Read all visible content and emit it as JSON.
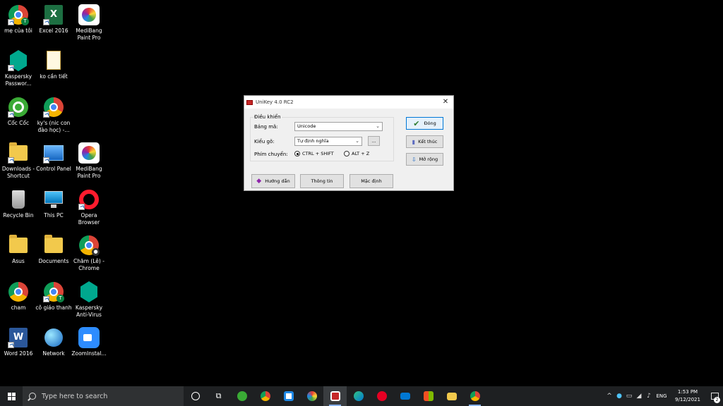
{
  "desktop_icons": [
    {
      "label": "mẹ của tôi",
      "icon": "chrome-profile-icon"
    },
    {
      "label": "Excel 2016",
      "icon": "excel-icon"
    },
    {
      "label": "MediBang Paint Pro",
      "icon": "medibang-icon"
    },
    {
      "label": "Kaspersky Passwor...",
      "icon": "kaspersky-icon"
    },
    {
      "label": "ko cần tiết",
      "icon": "document-icon"
    },
    {
      "label": "Cốc Cốc",
      "icon": "coccoc-icon"
    },
    {
      "label": "ky's (nic con đào học) -...",
      "icon": "chrome-profile-icon"
    },
    {
      "label": "Downloads - Shortcut",
      "icon": "folder-download-icon"
    },
    {
      "label": "Control Panel",
      "icon": "control-panel-icon"
    },
    {
      "label": "MediBang Paint Pro",
      "icon": "medibang-icon"
    },
    {
      "label": "Recycle Bin",
      "icon": "recycle-bin-icon"
    },
    {
      "label": "This PC",
      "icon": "this-pc-icon"
    },
    {
      "label": "Opera Browser",
      "icon": "opera-icon"
    },
    {
      "label": "Asus",
      "icon": "folder-user-icon"
    },
    {
      "label": "Documents",
      "icon": "documents-folder-icon"
    },
    {
      "label": "Chăm (Lê) - Chrome",
      "icon": "chrome-profile-icon"
    },
    {
      "label": "cham",
      "icon": "chrome-icon"
    },
    {
      "label": "cô giáo thanh",
      "icon": "chrome-profile-icon"
    },
    {
      "label": "Kaspersky Anti-Virus",
      "icon": "kaspersky-icon"
    },
    {
      "label": "Word 2016",
      "icon": "word-icon"
    },
    {
      "label": "Network",
      "icon": "network-icon"
    },
    {
      "label": "ZoomInstal...",
      "icon": "zoom-icon"
    }
  ],
  "unikey": {
    "title": "UniKey 4.0 RC2",
    "group_label": "Điều khiển",
    "bang_ma_label": "Bảng mã:",
    "bang_ma_value": "Unicode",
    "kieu_go_label": "Kiểu gõ:",
    "kieu_go_value": "Tự định nghĩa",
    "ellipsis_label": "...",
    "phim_chuyen_label": "Phím chuyển:",
    "radio1_label": "CTRL + SHIFT",
    "radio2_label": "ALT + Z",
    "radio_selected": "CTRL + SHIFT",
    "btn_dong": "Đóng",
    "btn_ket_thuc": "Kết thúc",
    "btn_mo_rong": "Mở rộng",
    "btn_huong_dan": "Hướng dẫn",
    "btn_thong_tin": "Thông tin",
    "btn_mac_dinh": "Mặc định"
  },
  "taskbar": {
    "search_placeholder": "Type here to search",
    "apps": [
      "cortana-icon",
      "task-view-icon",
      "coccoc-icon",
      "chrome-icon",
      "store-app-icon",
      "medibang-icon",
      "unikey-icon",
      "edge-icon",
      "pinterest-icon",
      "mail-icon",
      "store-icon",
      "file-explorer-icon",
      "chrome-profile-icon"
    ],
    "language": "ENG",
    "time": "1:53 PM",
    "date": "9/12/2021",
    "notification_count": "2"
  }
}
